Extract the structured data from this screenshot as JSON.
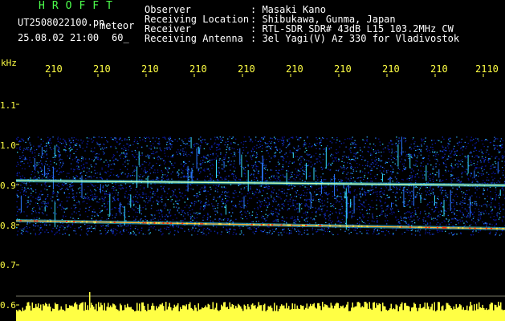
{
  "header": {
    "title": "HROFFT",
    "filename": "UT2508022100.pn",
    "mode": "meteor",
    "datetime": "25.08.02 21:00",
    "interval": "60_",
    "fields": [
      {
        "label": "Observer",
        "value": ": Masaki Kano"
      },
      {
        "label": "Receiving Location",
        "value": ": Shibukawa, Gunma, Japan"
      },
      {
        "label": "Receiver",
        "value": ": RTL-SDR SDR# 43dB L15 103.2MHz CW"
      },
      {
        "label": "Receiving Antenna",
        "value": ": 3el Yagi(V) Az 330 for Vladivostok"
      }
    ]
  },
  "axis": {
    "unit": "kHz",
    "time_labels": [
      "210",
      "210",
      "210",
      "210",
      "210",
      "210",
      "210",
      "210",
      "210",
      "2110"
    ],
    "freq_labels": [
      "1.1",
      "1.0",
      "0.9",
      "0.8",
      "0.7",
      "0.6"
    ]
  },
  "colors": {
    "background": "#000000",
    "axis": "#ffff44",
    "header_text": "#ffffff",
    "title": "#4cff4c",
    "spectrum_low": "#0a14a0",
    "spectrum_high": "#ff3000"
  },
  "signals": [
    {
      "label": "carrier-0.91",
      "freq_khz": 0.91
    },
    {
      "label": "carrier-0.81",
      "freq_khz": 0.81
    }
  ]
}
